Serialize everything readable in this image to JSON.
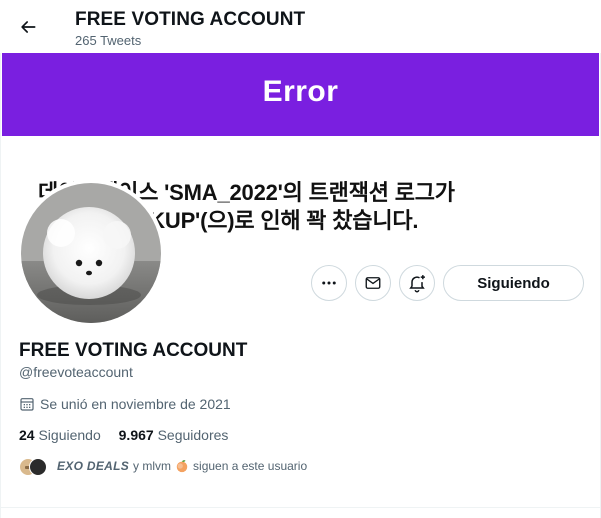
{
  "header": {
    "title": "FREE VOTING ACCOUNT",
    "tweet_count": "265 Tweets"
  },
  "banner": {
    "error_text": "Error",
    "line1": "데이터베이스 'SMA_2022'의 트랜잭션 로그가",
    "line2": "'LOG_BACKUP'(으)로 인해 꽉 찼습니다.",
    "bar_color": "#7a1fe0"
  },
  "avatar": {
    "icon": "pomeranian-photo-avatar"
  },
  "actions": {
    "more_icon": "more-icon",
    "message_icon": "envelope-icon",
    "notify_icon": "bell-plus-icon",
    "follow_label": "Siguiendo"
  },
  "profile": {
    "display_name": "FREE VOTING ACCOUNT",
    "handle": "@freevoteaccount",
    "joined": "Se unió en noviembre de 2021",
    "following_count": "24",
    "following_label": "Siguiendo",
    "followers_count": "9.967",
    "followers_label": "Seguidores"
  },
  "followed_by": {
    "name1": "EXO DEALS",
    "connector": "y mlvm",
    "suffix": "siguen a este usuario"
  },
  "colors": {
    "text_primary": "#0f1419",
    "text_secondary": "#536471",
    "border": "#cfd9de"
  }
}
